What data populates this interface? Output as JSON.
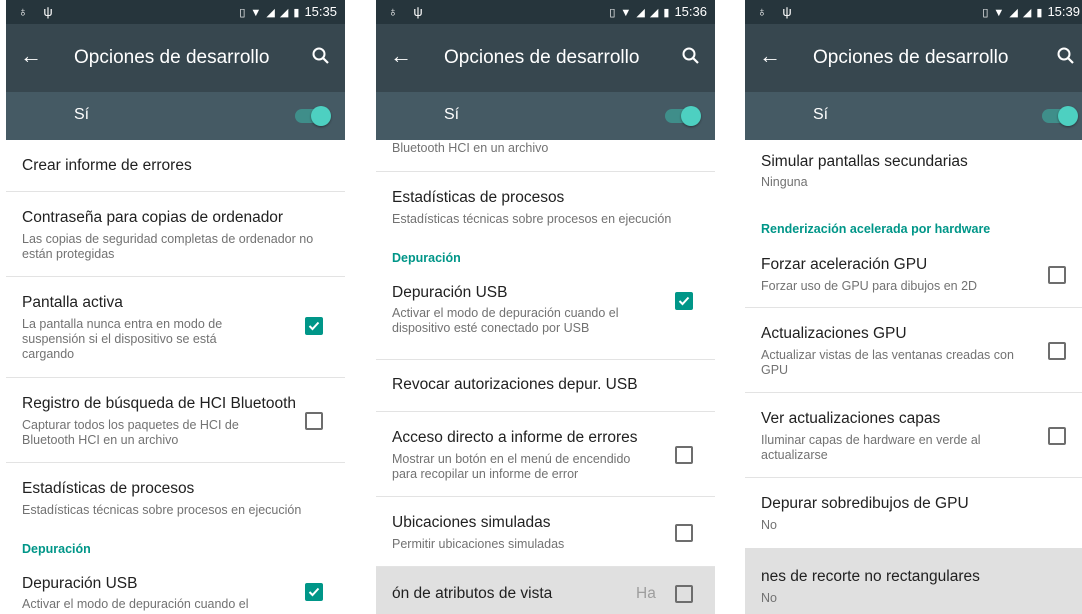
{
  "status": {
    "left_icons": "♁ ψ",
    "right_icons": "▯ ▼ ◢ ◢ ▮",
    "times": [
      "15:35",
      "15:36",
      "15:39"
    ]
  },
  "appbar": {
    "title": "Opciones de desarrollo"
  },
  "master_switch": {
    "label": "Sí",
    "on": true
  },
  "panels": [
    {
      "items": [
        {
          "title": "Crear informe de errores"
        },
        {
          "title": "Contraseña para copias de ordenador",
          "subtitle": "Las copias de seguridad completas de ordenador no están protegidas"
        },
        {
          "title": "Pantalla activa",
          "subtitle": "La pantalla nunca entra en modo de suspensión si el dispositivo se está cargando",
          "checked": true
        },
        {
          "title": "Registro de búsqueda de HCI Bluetooth",
          "subtitle": "Capturar todos los paquetes de HCI de Bluetooth HCI en un archivo",
          "checked": false
        },
        {
          "title": "Estadísticas de procesos",
          "subtitle": "Estadísticas técnicas sobre procesos en ejecución"
        },
        {
          "section": "Depuración"
        },
        {
          "title": "Depuración USB",
          "subtitle": "Activar el modo de depuración cuando el",
          "checked": true
        }
      ]
    },
    {
      "items": [
        {
          "subtitle": "Bluetooth HCI en un archivo"
        },
        {
          "title": "Estadísticas de procesos",
          "subtitle": "Estadísticas técnicas sobre procesos en ejecución"
        },
        {
          "section": "Depuración"
        },
        {
          "title": "Depuración USB",
          "subtitle": "Activar el modo de depuración cuando el dispositivo esté conectado por USB",
          "checked": true
        },
        {
          "title": "Revocar autorizaciones depur. USB"
        },
        {
          "title": "Acceso directo a informe de errores",
          "subtitle": "Mostrar un botón en el menú de encendido para recopilar un informe de error",
          "checked": false
        },
        {
          "title": "Ubicaciones simuladas",
          "subtitle": "Permitir ubicaciones simuladas",
          "checked": false
        },
        {
          "title": "ón de atributos de vista",
          "trailing": "Ha",
          "checked": false,
          "pressed": true
        }
      ]
    },
    {
      "items": [
        {
          "title": "Simular pantallas secundarias",
          "subtitle": "Ninguna"
        },
        {
          "section": "Renderización acelerada por hardware"
        },
        {
          "title": "Forzar aceleración GPU",
          "subtitle": "Forzar uso de GPU para dibujos en 2D",
          "checked": false
        },
        {
          "title": "Actualizaciones GPU",
          "subtitle": "Actualizar vistas de las ventanas creadas con GPU",
          "checked": false
        },
        {
          "title": "Ver actualizaciones capas",
          "subtitle": "Iluminar capas de hardware en verde al actualizarse",
          "checked": false
        },
        {
          "title": "Depurar sobredibujos de GPU",
          "subtitle": "No"
        },
        {
          "title": "nes de recorte no rectangulares",
          "subtitle": "No",
          "pressed": true
        }
      ]
    }
  ]
}
